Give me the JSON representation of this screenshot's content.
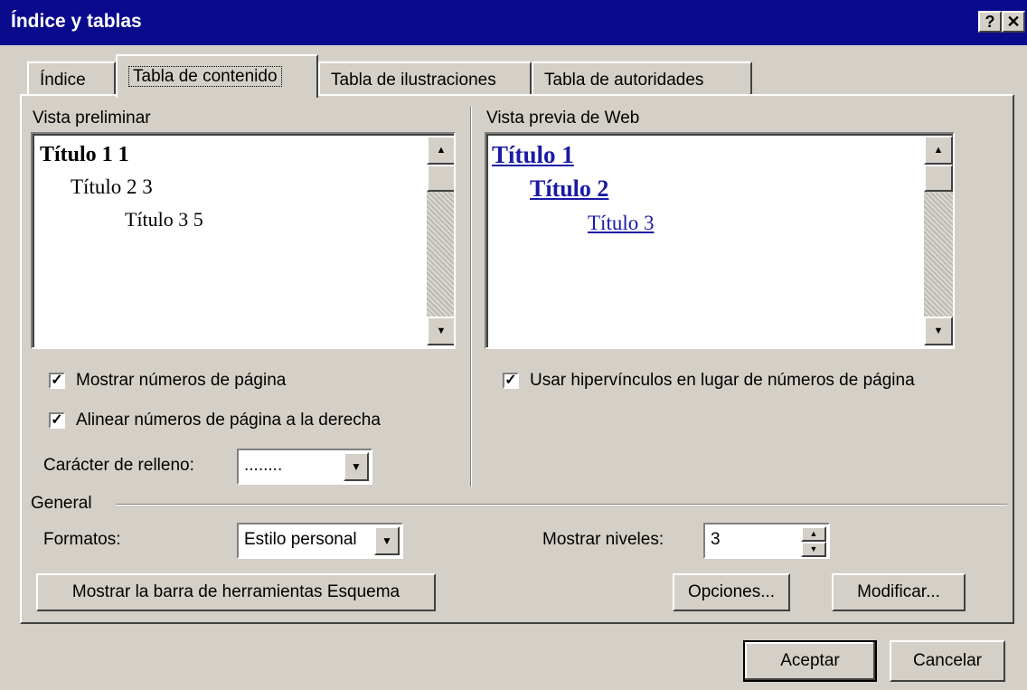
{
  "window": {
    "title": "Índice y tablas",
    "help_label": "?",
    "close_label": "✕"
  },
  "tabs": [
    {
      "label": "Índice"
    },
    {
      "label": "Tabla de contenido"
    },
    {
      "label": "Tabla de ilustraciones"
    },
    {
      "label": "Tabla de autoridades"
    }
  ],
  "print_preview": {
    "label": "Vista preliminar",
    "lines": [
      "Título 1 1",
      "Título 2 3",
      "Título 3 5"
    ]
  },
  "web_preview": {
    "label": "Vista previa de Web",
    "lines": [
      "Título 1",
      "Título 2",
      "Título 3"
    ]
  },
  "options": {
    "show_page_numbers": {
      "label": "Mostrar números de página",
      "checked": true
    },
    "align_right": {
      "label": "Alinear números de página a la derecha",
      "checked": true
    },
    "use_hyperlinks": {
      "label": "Usar hipervínculos en lugar de números de página",
      "checked": true
    },
    "tab_leader": {
      "label": "Carácter de relleno:",
      "value": "........"
    }
  },
  "general": {
    "group_label": "General",
    "formats_label": "Formatos:",
    "formats_value": "Estilo personal",
    "levels_label": "Mostrar niveles:",
    "levels_value": "3",
    "outline_toolbar_button": "Mostrar la barra de herramientas Esquema",
    "options_button": "Opciones...",
    "modify_button": "Modificar..."
  },
  "footer": {
    "ok_button": "Aceptar",
    "cancel_button": "Cancelar"
  },
  "colors": {
    "titlebar": "#0a0a8c",
    "dialog": "#d4d0c8",
    "link": "#1a1aa6"
  }
}
